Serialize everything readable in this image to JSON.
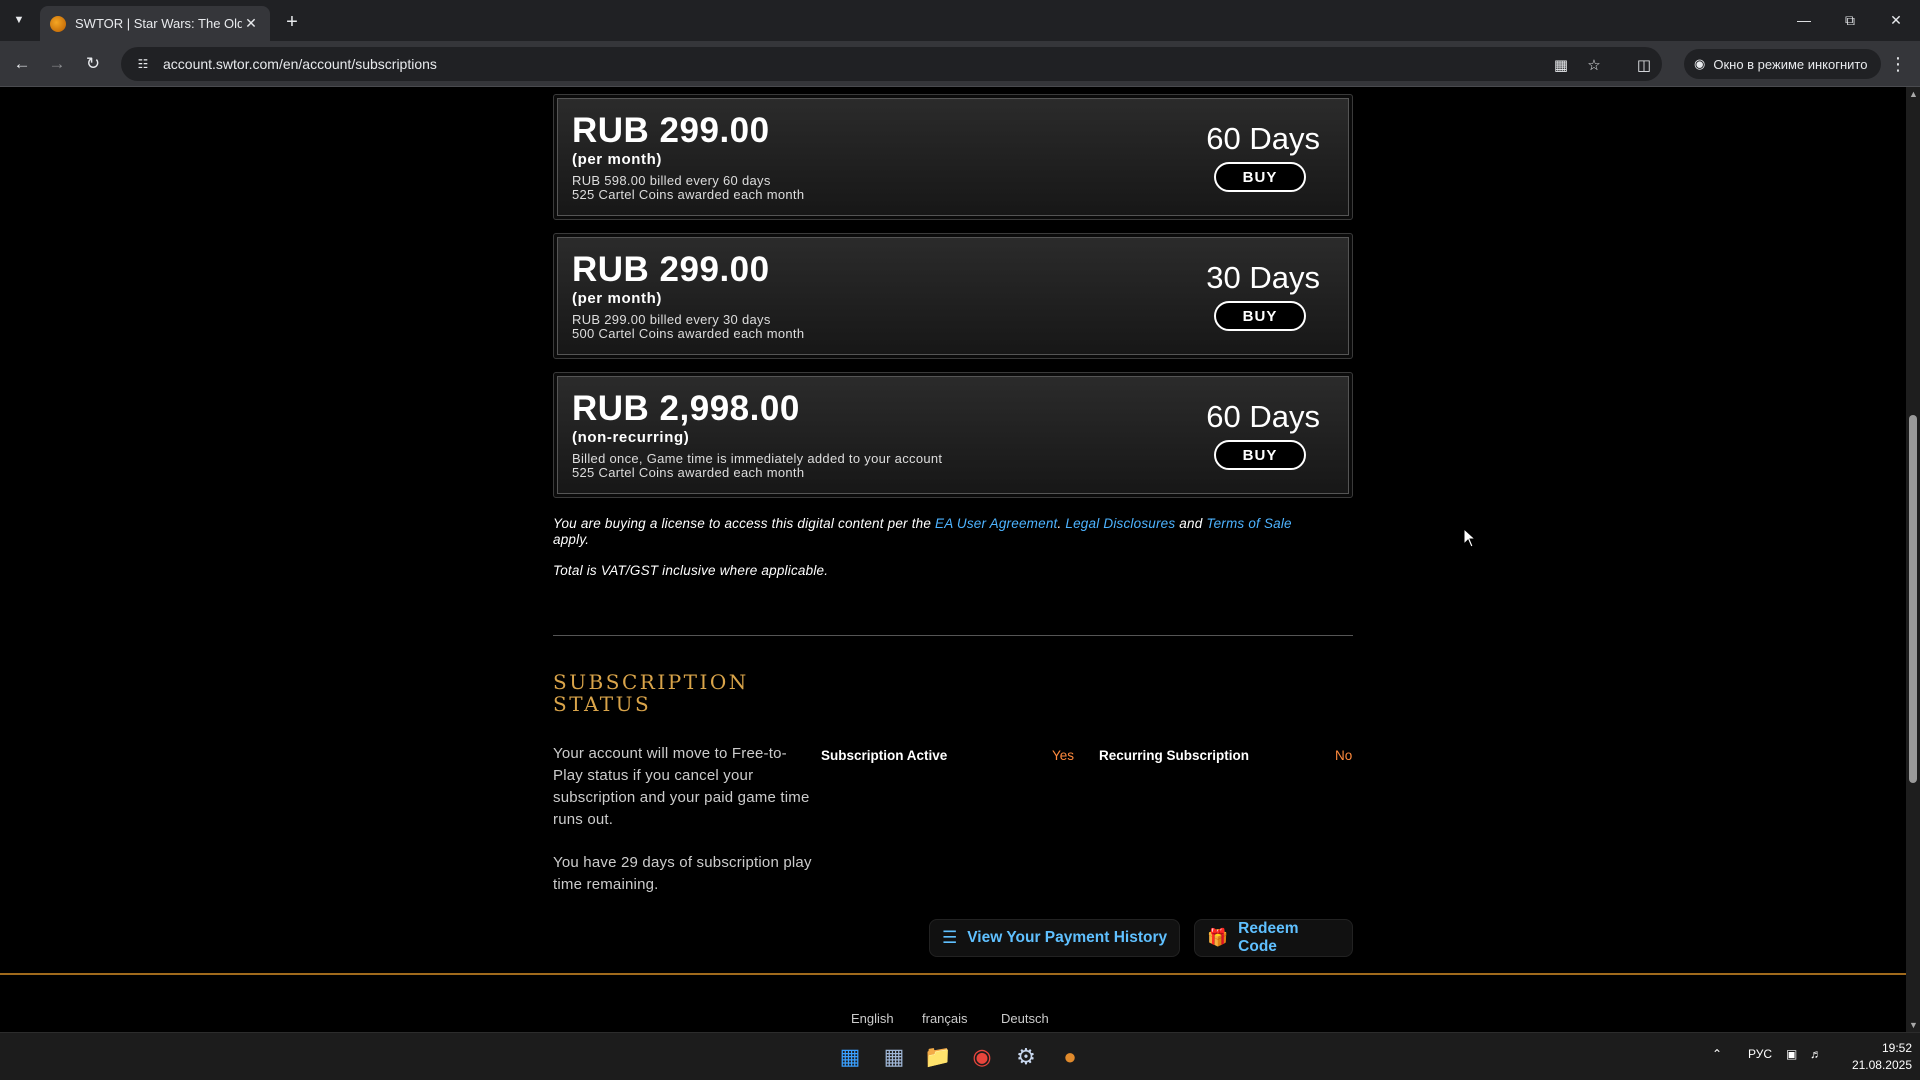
{
  "browser": {
    "tab_title": "SWTOR | Star Wars: The Old Re",
    "url": "account.swtor.com/en/account/subscriptions",
    "incognito_label": "Окно в режиме инкогнито"
  },
  "plans": [
    {
      "price": "RUB 299.00",
      "period": "(per month)",
      "line1": "RUB 598.00 billed every 60 days",
      "line2": "525 Cartel Coins awarded each month",
      "days": "60 Days",
      "buy_label": "BUY"
    },
    {
      "price": "RUB 299.00",
      "period": "(per month)",
      "line1": "RUB 299.00 billed every 30 days",
      "line2": "500 Cartel Coins awarded each month",
      "days": "30 Days",
      "buy_label": "BUY"
    },
    {
      "price": "RUB 2,998.00",
      "period": "(non-recurring)",
      "line1": "Billed once, Game time is immediately added to your account",
      "line2": "525 Cartel Coins awarded each month",
      "days": "60 Days",
      "buy_label": "BUY"
    }
  ],
  "legal": {
    "prefix": "You are buying a license to access this digital content per the ",
    "link1": "EA User Agreement",
    "sep1": ". ",
    "link2": "Legal Disclosures",
    "sep2": " and ",
    "link3": "Terms of Sale",
    "suffix": " apply.",
    "vat": "Total is VAT/GST inclusive where applicable."
  },
  "status": {
    "title": "SUBSCRIPTION STATUS",
    "desc": "Your account will move to Free-to-Play status if you cancel your subscription and your paid game time runs out.",
    "remaining": "You have 29 days of subscription play time remaining.",
    "active_label": "Subscription Active",
    "active_value": "Yes",
    "recurring_label": "Recurring Subscription",
    "recurring_value": "No"
  },
  "actions": {
    "payment_history": "View Your Payment History",
    "redeem": "Redeem Code"
  },
  "footer": {
    "languages": [
      "English",
      "français",
      "Deutsch"
    ]
  },
  "taskbar": {
    "lang": "РУС",
    "time": "19:52",
    "date": "21.08.2025"
  }
}
